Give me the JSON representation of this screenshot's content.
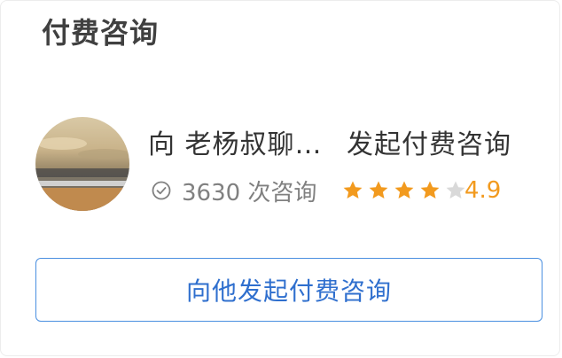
{
  "section": {
    "title": "付费咨询"
  },
  "consultant": {
    "name_line": "向 老杨叔聊…",
    "start_link_label": "发起付费咨询",
    "consult_count": "3630 次咨询",
    "rating_value": "4.9",
    "stars_filled": 4,
    "stars_total": 5
  },
  "action": {
    "button_label": "向他发起付费咨询"
  },
  "colors": {
    "accent_blue": "#2f6fce",
    "button_border": "#4a8fe0",
    "star_filled": "#f29a1e",
    "star_empty": "#d9d9d9",
    "title_text": "#404040",
    "body_text": "#333333",
    "muted_text": "#808080"
  }
}
